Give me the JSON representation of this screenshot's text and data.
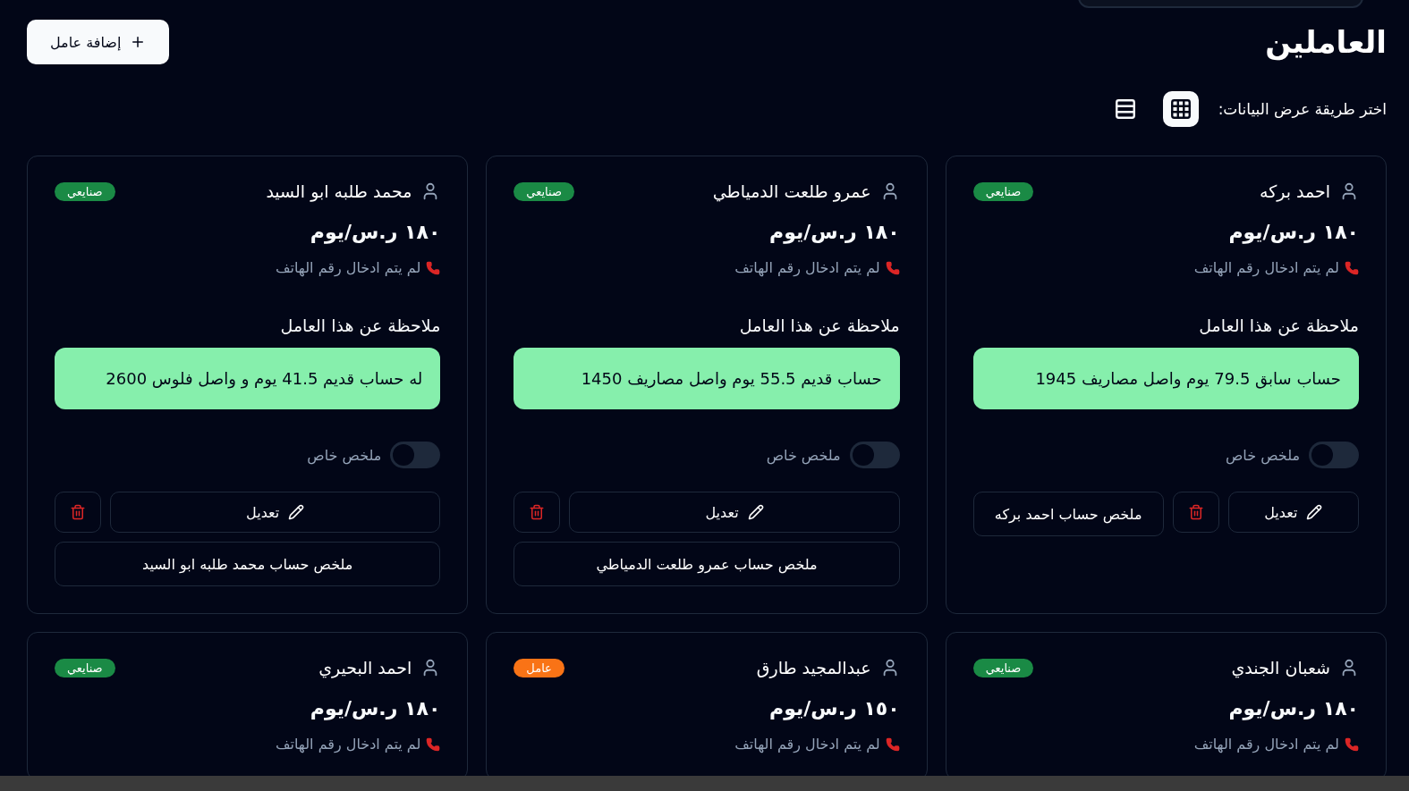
{
  "title": "العاملين",
  "add_button": {
    "label": "إضافة عامل"
  },
  "view_picker": {
    "label": "اختر طريقة عرض البيانات:",
    "options": [
      {
        "kind": "grid",
        "selected": true
      },
      {
        "kind": "list",
        "selected": false
      }
    ]
  },
  "workers": [
    {
      "name": "احمد بركه",
      "badge": {
        "label": "صنايعي",
        "color": "#1a8a45"
      },
      "wage": "١٨٠ ر.س/يوم",
      "phone": "لم يتم ادخال رقم الهاتف",
      "note_title": "ملاحظة عن هذا العامل",
      "note": "حساب سابق 79.5 يوم واصل مصاريف 1945",
      "toggle": {
        "label": "ملخص خاص",
        "on": false
      },
      "edit_label": "تعديل",
      "summary_label": "ملخص حساب احمد بركه"
    },
    {
      "name": "عمرو طلعت الدمياطي",
      "badge": {
        "label": "صنايعي",
        "color": "#1a8a45"
      },
      "wage": "١٨٠ ر.س/يوم",
      "phone": "لم يتم ادخال رقم الهاتف",
      "note_title": "ملاحظة عن هذا العامل",
      "note": "حساب قديم 55.5 يوم واصل مصاريف 1450",
      "toggle": {
        "label": "ملخص خاص",
        "on": false
      },
      "edit_label": "تعديل",
      "summary_label": "ملخص حساب عمرو طلعت الدمياطي"
    },
    {
      "name": "محمد طلبه ابو السيد",
      "badge": {
        "label": "صنايعي",
        "color": "#1a8a45"
      },
      "wage": "١٨٠ ر.س/يوم",
      "phone": "لم يتم ادخال رقم الهاتف",
      "note_title": "ملاحظة عن هذا العامل",
      "note": "له حساب قديم 41.5 يوم و واصل فلوس 2600",
      "toggle": {
        "label": "ملخص خاص",
        "on": false
      },
      "edit_label": "تعديل",
      "summary_label": "ملخص حساب محمد طلبه ابو السيد"
    },
    {
      "name": "شعبان الجندي",
      "badge": {
        "label": "صنايعي",
        "color": "#1a8a45"
      },
      "wage": "١٨٠ ر.س/يوم",
      "phone": "لم يتم ادخال رقم الهاتف"
    },
    {
      "name": "عبدالمجيد طارق",
      "badge": {
        "label": "عامل",
        "color": "#f97316"
      },
      "wage": "١٥٠ ر.س/يوم",
      "phone": "لم يتم ادخال رقم الهاتف"
    },
    {
      "name": "احمد البحيري",
      "badge": {
        "label": "صنايعي",
        "color": "#1a8a45"
      },
      "wage": "١٨٠ ر.س/يوم",
      "phone": "لم يتم ادخال رقم الهاتف"
    }
  ]
}
